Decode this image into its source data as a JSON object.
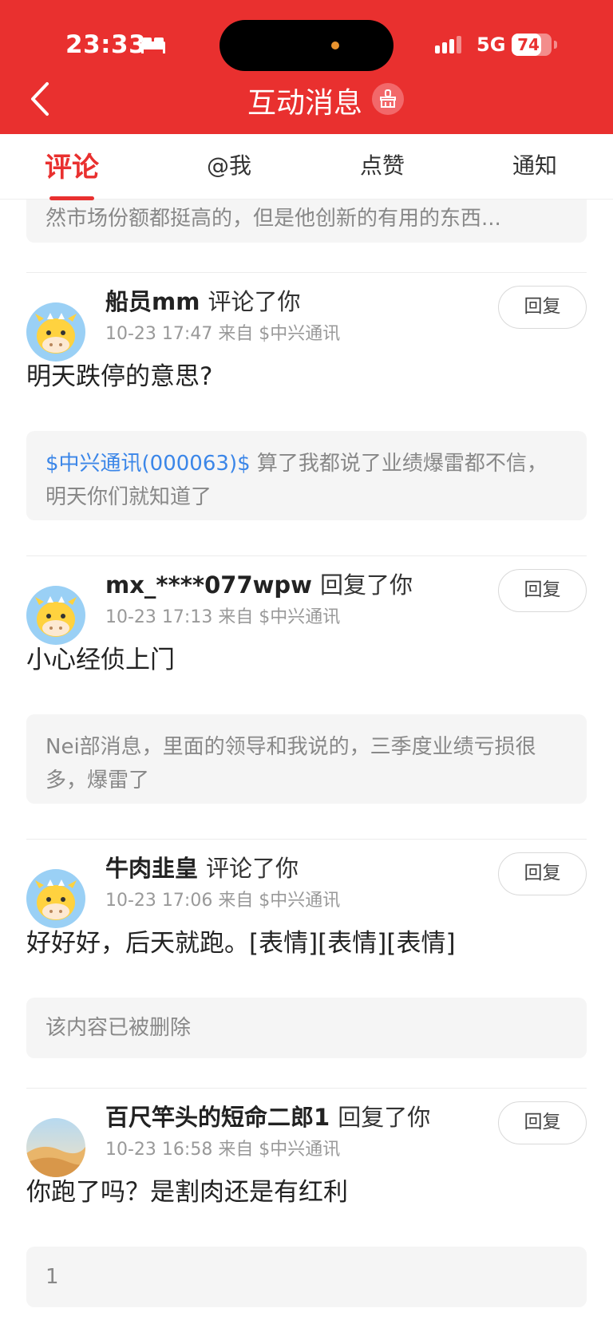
{
  "status_bar": {
    "time": "23:33",
    "network": "5G",
    "battery": "74",
    "battery_fraction": 0.74
  },
  "header": {
    "title": "互动消息"
  },
  "tabs": [
    {
      "label": "评论",
      "active": true
    },
    {
      "label": "@我",
      "active": false
    },
    {
      "label": "点赞",
      "active": false
    },
    {
      "label": "通知",
      "active": false
    }
  ],
  "top_partial_quote": "然市场份额都挺高的，但是他创新的有用的东西...",
  "items": [
    {
      "name": "船员mm",
      "action": "评论了你",
      "meta": "10-23 17:47 来自 $中兴通讯",
      "reply_label": "回复",
      "content": "明天跌停的意思?",
      "quote_link": "$中兴通讯(000063)$",
      "quote_text": " 算了我都说了业绩爆雷都不信，明天你们就知道了",
      "avatar": "cow-avatar"
    },
    {
      "name": "mx_****077wpw",
      "action": "回复了你",
      "meta": "10-23 17:13 来自 $中兴通讯",
      "reply_label": "回复",
      "content": "小心经侦上门",
      "quote_link": "",
      "quote_text": "Nei部消息，里面的领导和我说的，三季度业绩亏损很多，爆雷了",
      "avatar": "cow-avatar"
    },
    {
      "name": "牛肉韭皇",
      "action": "评论了你",
      "meta": "10-23 17:06 来自 $中兴通讯",
      "reply_label": "回复",
      "content": "好好好，后天就跑。[表情][表情][表情]",
      "quote_link": "",
      "quote_text": "该内容已被删除",
      "avatar": "cow-avatar"
    },
    {
      "name": "百尺竿头的短命二郎1",
      "action": "回复了你",
      "meta": "10-23 16:58 来自 $中兴通讯",
      "reply_label": "回复",
      "content": "你跑了吗？是割肉还是有红利",
      "quote_link": "",
      "quote_text": "1",
      "avatar": "desert-avatar"
    }
  ],
  "colors": {
    "brand_red": "#e9302f",
    "link_blue": "#3b86e8"
  }
}
